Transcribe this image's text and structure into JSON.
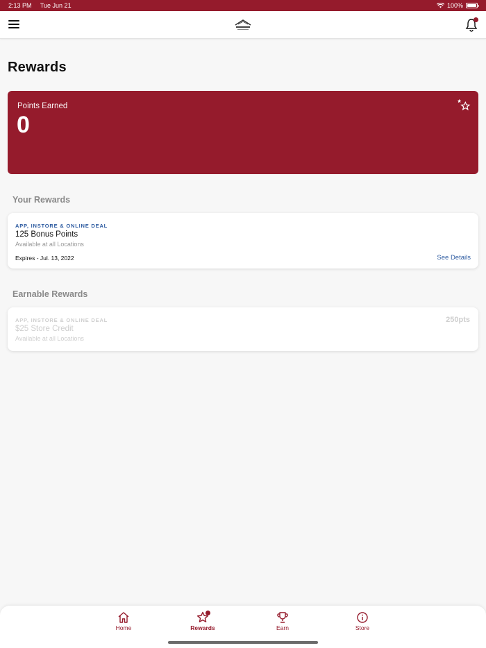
{
  "status_bar": {
    "time": "2:13 PM",
    "date": "Tue Jun 21",
    "battery": "100%"
  },
  "page": {
    "title": "Rewards"
  },
  "points_card": {
    "label": "Points Earned",
    "value": "0"
  },
  "your_rewards": {
    "section_title": "Your Rewards",
    "items": [
      {
        "tag": "APP, INSTORE & ONLINE DEAL",
        "title": "125 Bonus Points",
        "subtitle": "Available at all Locations",
        "expiry": "Expires - Jul. 13, 2022",
        "action": "See Details"
      }
    ]
  },
  "earnable_rewards": {
    "section_title": "Earnable Rewards",
    "items": [
      {
        "tag": "APP, INSTORE & ONLINE DEAL",
        "title": "$25 Store Credit",
        "subtitle": "Available at all Locations",
        "points": "250pts"
      }
    ]
  },
  "tab_bar": {
    "tabs": [
      {
        "label": "Home",
        "icon": "home-icon"
      },
      {
        "label": "Rewards",
        "icon": "star-icon"
      },
      {
        "label": "Earn",
        "icon": "trophy-icon"
      },
      {
        "label": "Store",
        "icon": "info-icon"
      }
    ]
  },
  "colors": {
    "brand": "#951b2c",
    "link": "#2c5aa0"
  }
}
